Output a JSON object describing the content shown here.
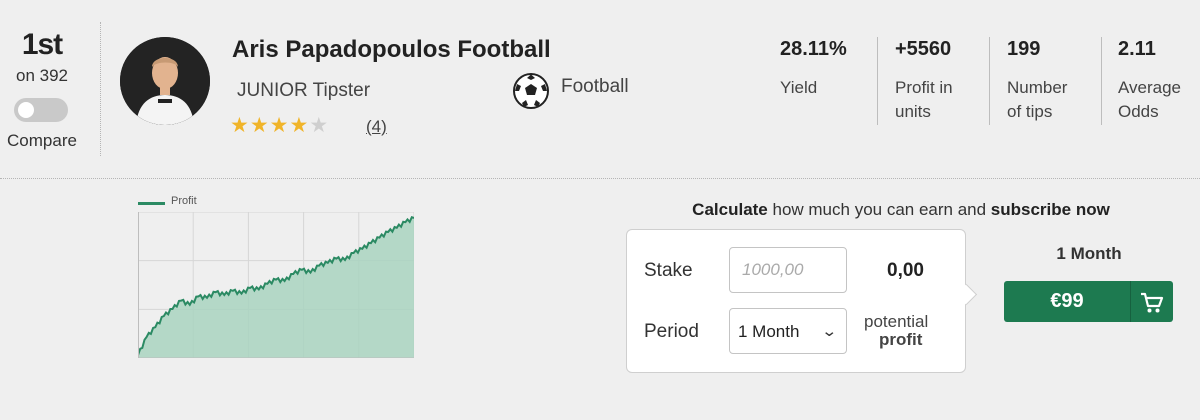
{
  "rank": {
    "position": "1st",
    "of": "on 392",
    "compare_label": "Compare"
  },
  "tipster": {
    "name": "Aris Papadopoulos Football",
    "level": "JUNIOR Tipster",
    "rating_stars": 4,
    "rating_max": 5,
    "reviews": "(4)",
    "sport": "Football",
    "sport_icon": "soccer-ball-icon",
    "avatar_icon": "person-avatar"
  },
  "stats": [
    {
      "value": "28.11%",
      "label_lines": [
        "Yield"
      ]
    },
    {
      "value": "+5560",
      "label_lines": [
        "Profit in",
        "units"
      ]
    },
    {
      "value": "199",
      "label_lines": [
        "Number",
        "of tips"
      ]
    },
    {
      "value": "2.11",
      "label_lines": [
        "Average",
        "Odds"
      ]
    }
  ],
  "chart_data": {
    "type": "area",
    "legend": [
      "Profit"
    ],
    "grid": true,
    "series": [
      {
        "name": "Profit",
        "color": "#2b8a63",
        "fill": "#a9d3c0",
        "values": [
          2,
          15,
          22,
          30,
          35,
          41,
          38,
          44,
          43,
          47,
          45,
          48,
          46,
          50,
          49,
          53,
          56,
          55,
          60,
          63,
          61,
          66,
          68,
          71,
          70,
          75,
          78,
          82,
          86,
          90,
          93,
          97,
          100
        ]
      }
    ],
    "ylim": [
      0,
      100
    ]
  },
  "calculator": {
    "title_bold_1": "Calculate",
    "title_mid": " how much you can earn and ",
    "title_bold_2": "subscribe now",
    "stake_label": "Stake",
    "stake_placeholder": "1000,00",
    "result": "0,00",
    "period_label": "Period",
    "period_value": "1 Month",
    "potential": "potential",
    "profit": "profit"
  },
  "subscribe": {
    "plan": "1 Month",
    "price": "€99",
    "icon": "cart-icon"
  },
  "colors": {
    "accent": "#1d7a50",
    "star": "#f0b429",
    "chart_line": "#2b8a63",
    "chart_fill": "#a9d3c0"
  }
}
